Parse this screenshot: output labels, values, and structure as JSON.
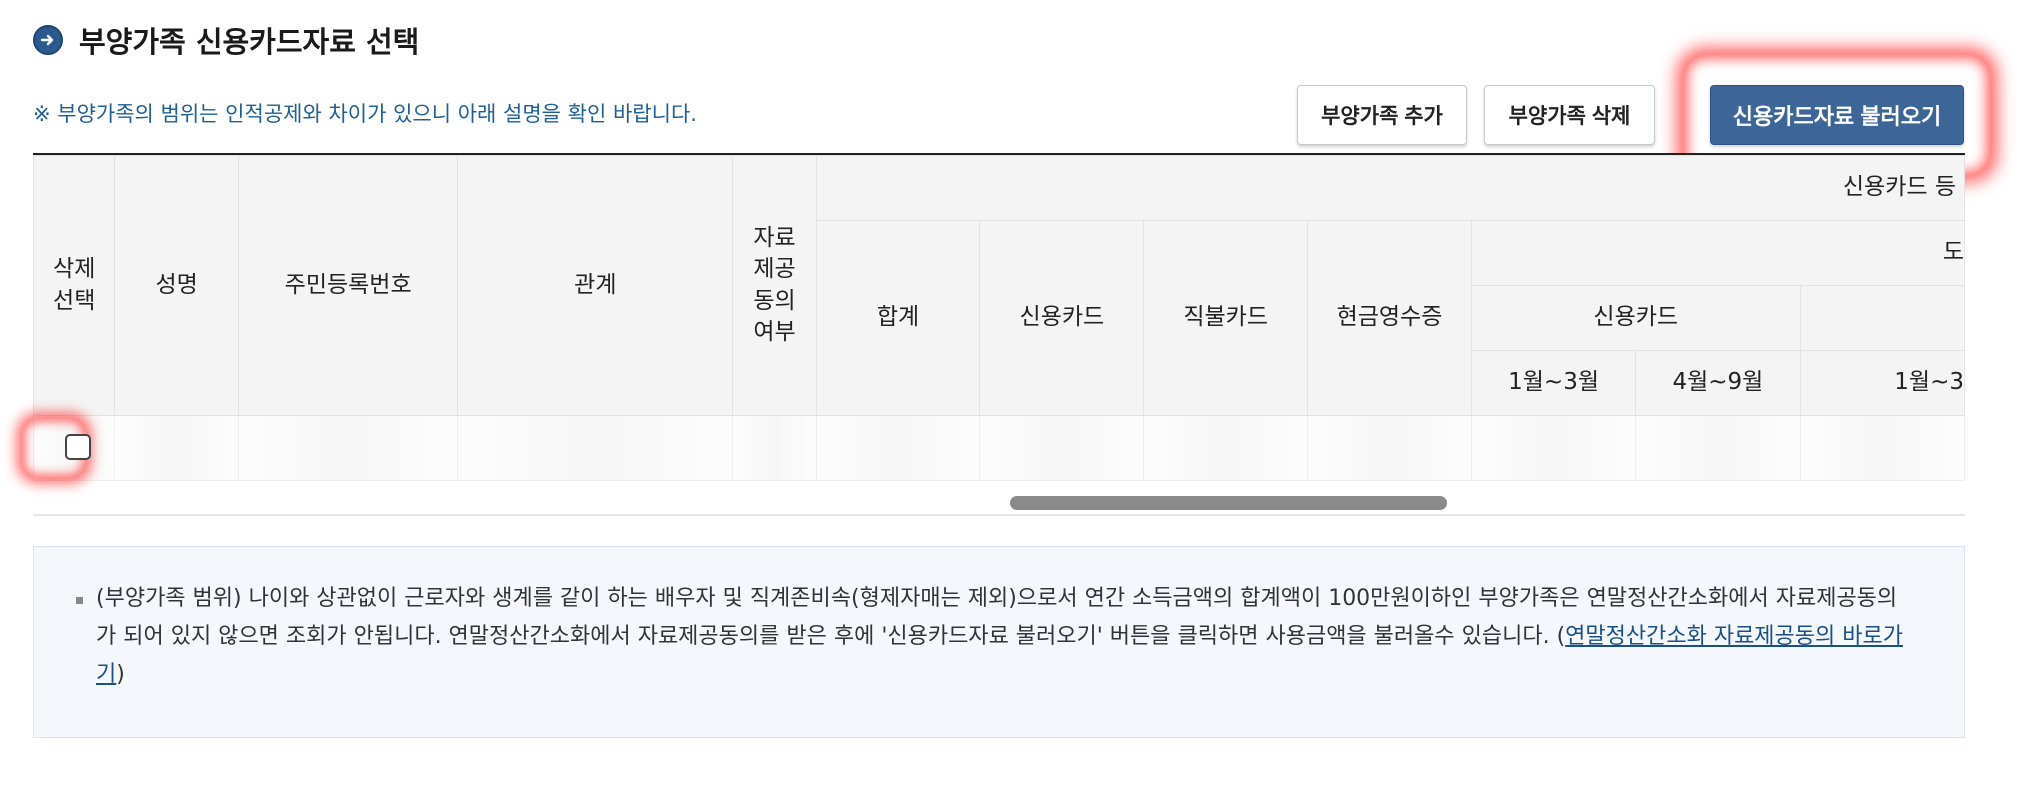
{
  "section": {
    "title": "부양가족 신용카드자료 선택",
    "notice": "※ 부양가족의 범위는 인적공제와 차이가 있으니 아래 설명을 확인 바랍니다."
  },
  "buttons": {
    "add": "부양가족 추가",
    "delete": "부양가족 삭제",
    "load": "신용카드자료 불러오기"
  },
  "table": {
    "headers": {
      "delete_select": "삭제\n선택",
      "name": "성명",
      "resident_no": "주민등록번호",
      "relation": "관계",
      "consent": "자료\n제공\n동의\n여부",
      "group_top": "신용카드 등",
      "total": "합계",
      "credit_card": "신용카드",
      "debit_card": "직불카드",
      "cash_receipt": "현금영수증",
      "sub_group_cut": "도",
      "credit_card_sub": "신용카드",
      "m1_3": "1월~3월",
      "m4_9": "4월~9월",
      "m1_3_cut": "1월~3"
    }
  },
  "info": {
    "text": "(부양가족 범위) 나이와 상관없이 근로자와 생계를 같이 하는 배우자 및 직계존비속(형제자매는 제외)으로서 연간 소득금액의 합계액이 100만원이하인 부양가족은 연말정산간소화에서 자료제공동의가 되어 있지 않으면 조회가 안됩니다. 연말정산간소화에서 자료제공동의를 받은 후에 '신용카드자료 불러오기' 버튼을 클릭하면 사용금액을 불러올수 있습니다. (",
    "link": "연말정산간소화 자료제공동의 바로가기",
    "close_paren": ")"
  }
}
